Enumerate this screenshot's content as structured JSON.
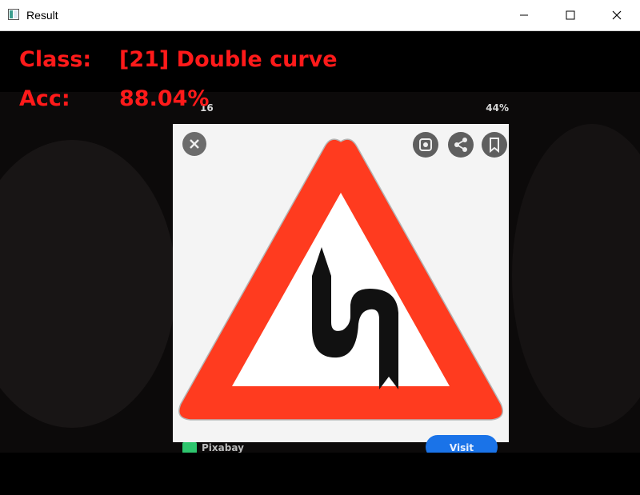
{
  "window": {
    "title": "Result",
    "controls": {
      "minimize": "minimize-icon",
      "maximize": "maximize-icon",
      "close": "close-icon"
    }
  },
  "overlay": {
    "class_label": "Class:",
    "class_value": "[21] Double curve",
    "acc_label": "Acc:",
    "acc_value": "88.04%",
    "text_color": "#ff1a1a"
  },
  "phone": {
    "status_time": "16",
    "status_battery": "44%",
    "source_name": "Pixabay",
    "visit_button": "Visit"
  },
  "sign": {
    "border_color": "#ff3b1f",
    "fill_color": "#ffffff",
    "symbol_color": "#111111"
  }
}
